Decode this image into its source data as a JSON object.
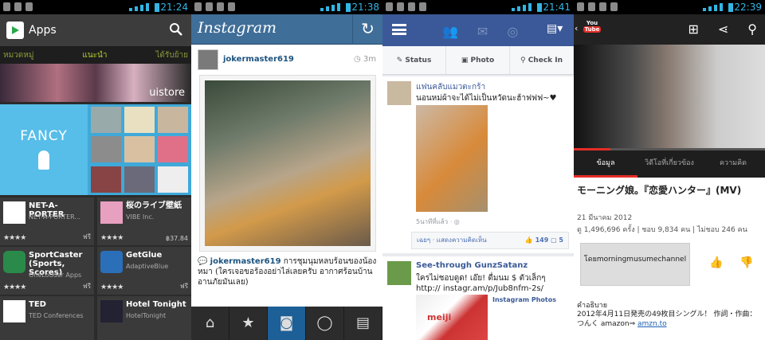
{
  "status_bars": [
    {
      "time": "21:24"
    },
    {
      "time": "21:38"
    },
    {
      "time": "21:41"
    },
    {
      "time": "22:39"
    }
  ],
  "playstore": {
    "title": "Apps",
    "tabs": [
      "หมวดหมู่",
      "แนะนำ",
      "ได้รับย้าย"
    ],
    "banner_label": "uistore",
    "featured_label": "FANCY",
    "cards": [
      {
        "name": "NET-A-PORTER",
        "dev": "NET-A-PORTER...",
        "price": "ฟรี",
        "stars": "★★★★"
      },
      {
        "name": "桜のライブ壁紙",
        "dev": "VIBE Inc.",
        "price": "฿37.84",
        "stars": "★★★★"
      },
      {
        "name": "SportCaster (Sports, Scores)",
        "dev": "OneLouder Apps",
        "price": "ฟรี",
        "stars": "★★★★"
      },
      {
        "name": "GetGlue",
        "dev": "AdaptiveBlue",
        "price": "ฟรี",
        "stars": "★★★★"
      },
      {
        "name": "TED",
        "dev": "TED Conferences",
        "price": "ฟรี",
        "stars": "★★★★"
      },
      {
        "name": "Hotel Tonight",
        "dev": "HotelTonight",
        "price": "ฟรี",
        "stars": "★★★★"
      }
    ]
  },
  "instagram": {
    "logo": "Instagram",
    "username": "jokermaster619",
    "time": "3m",
    "caption_user": "jokermaster619",
    "caption_text": " การชุมนุมหลบร้อนของน้องหมา (ใครเจอขอร้องอย่าไล่เลยครับ อากาศร้อนบ้านอานภัยมันเลย)"
  },
  "facebook": {
    "actions": [
      "Status",
      "Photo",
      "Check In"
    ],
    "post1": {
      "name": "แฟนคลับแมวตะกร้า",
      "text": "นอนหม่ผ้าจะได้ไม่เป็นหวัดนะฮ้าฟฟฟ~♥",
      "time": "5นาทีที่แล้ว · ",
      "like_text": "เฉยๆ · แสดงความคิดเห็น",
      "likes": "149",
      "comments": "5"
    },
    "post2": {
      "name": "See-through GunzSatanz",
      "text": "ใครไม่ชอบดูด! เอ๊ย! ดื่มนม $ ตัวเล็กๆ http:// instagr.am/p/Jub8nfm-2s/",
      "album": "Instagram Photos",
      "brand": "meiji"
    }
  },
  "youtube": {
    "logo_you": "You",
    "logo_tube": "Tube",
    "tabs": [
      "ข้อมูล",
      "วิดีโอที่เกี่ยวข้อง",
      "ความคิด"
    ],
    "title": "モーニング娘。『恋愛ハンター』(MV)",
    "date": "21 มีนาคม 2012",
    "stats": "ดู 1,496,696 ครั้ง | ชอบ 9,834 คน | ไม่ชอบ 246 คน",
    "uploader": "โดยmorningmusumechannel",
    "desc_heading": "คำอธิบาย",
    "desc_text": "2012年4月11日発売の49枚目シングル！ 作詞・作曲：つんく amazon⇒ ",
    "desc_link": "amzn.to"
  }
}
